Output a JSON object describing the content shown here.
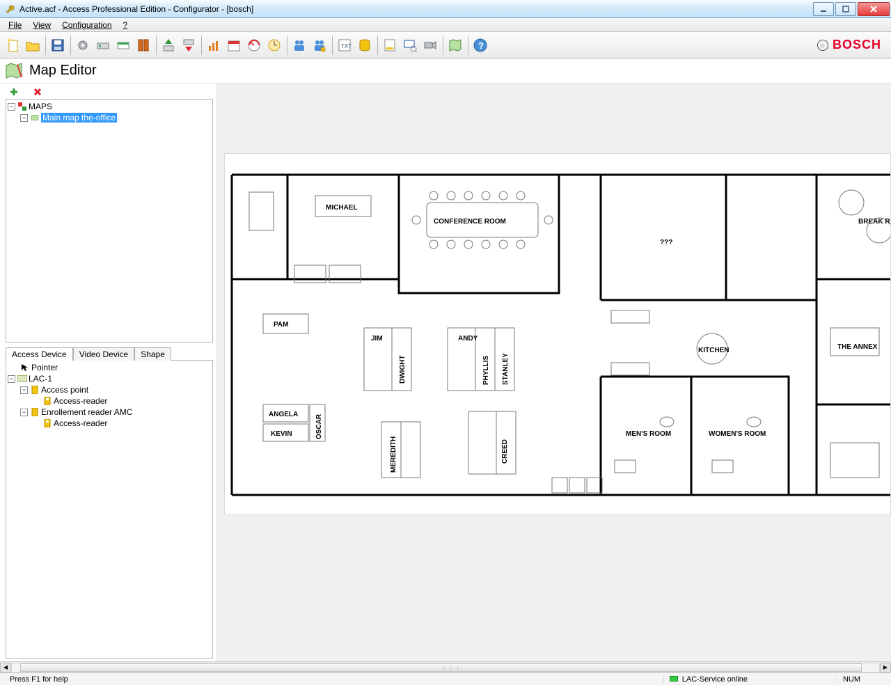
{
  "window": {
    "title": "Active.acf - Access Professional Edition - Configurator - [bosch]"
  },
  "menu": {
    "file": "File",
    "view": "View",
    "configuration": "Configuration",
    "help": "?"
  },
  "brand": {
    "name": "BOSCH"
  },
  "editor": {
    "title": "Map Editor"
  },
  "tree": {
    "root_label": "MAPS",
    "selected_label": "Main map the-office"
  },
  "tabs": {
    "access": "Access Device",
    "video": "Video Device",
    "shape": "Shape"
  },
  "devices": {
    "pointer": "Pointer",
    "lac": "LAC-1",
    "access_point": "Access point",
    "access_reader_1": "Access-reader",
    "enroll_reader": "Enrollement reader AMC",
    "access_reader_2": "Access-reader"
  },
  "floorplan": {
    "labels": {
      "michael": "MICHAEL",
      "conference": "CONFERENCE ROOM",
      "break": "BREAK R",
      "pam": "PAM",
      "jim": "JIM",
      "dwight": "DWIGHT",
      "andy": "ANDY",
      "phyllis": "PHYLLIS",
      "stanley": "STANLEY",
      "kitchen": "KITCHEN",
      "the_annex": "THE ANNEX",
      "angela": "ANGELA",
      "kevin": "KEVIN",
      "oscar": "OSCAR",
      "meredith": "MEREDITH",
      "creed": "CREED",
      "mens": "MEN'S ROOM",
      "womens": "WOMEN'S ROOM",
      "unknown": "???"
    }
  },
  "status": {
    "hint": "Press F1 for help",
    "service": "LAC-Service online",
    "num": "NUM"
  }
}
